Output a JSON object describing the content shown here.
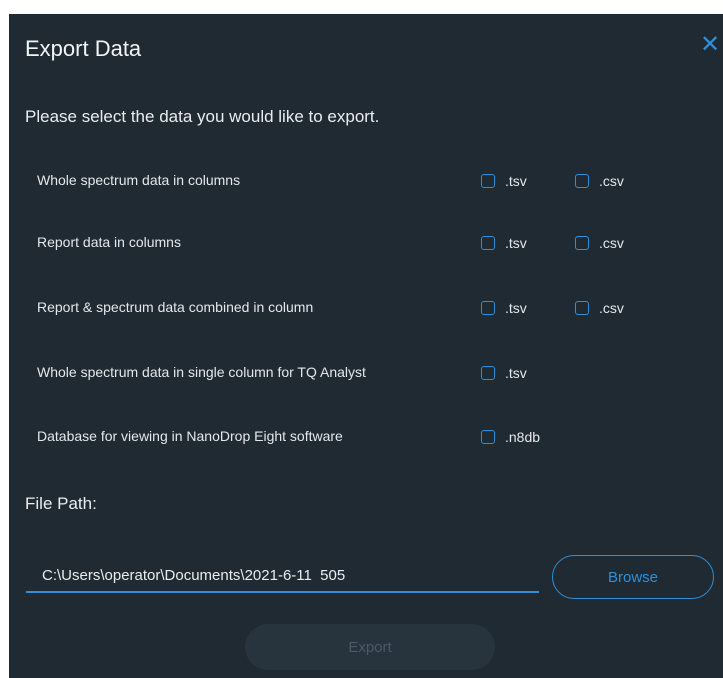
{
  "dialog": {
    "title": "Export Data",
    "close_glyph": "✕",
    "close_icon": "close-icon",
    "instruction": "Please select the data you would like to export.",
    "options": [
      {
        "label": "Whole spectrum data in columns",
        "formats": [
          ".tsv",
          ".csv"
        ],
        "checked": [
          false,
          false
        ]
      },
      {
        "label": "Report data in columns",
        "formats": [
          ".tsv",
          ".csv"
        ],
        "checked": [
          false,
          false
        ]
      },
      {
        "label": "Report & spectrum data combined in column",
        "formats": [
          ".tsv",
          ".csv"
        ],
        "checked": [
          false,
          false
        ]
      },
      {
        "label": "Whole spectrum data in single column for TQ Analyst",
        "formats": [
          ".tsv"
        ],
        "checked": [
          false
        ]
      },
      {
        "label": "Database for viewing in NanoDrop Eight software",
        "formats": [
          ".n8db"
        ],
        "checked": [
          false
        ]
      }
    ],
    "file_path_label": "File Path:",
    "file_path_value": "C:\\Users\\operator\\Documents\\2021-6-11  505",
    "browse_label": "Browse",
    "export_label": "Export",
    "export_enabled": false
  },
  "colors": {
    "background": "#1f2a33",
    "accent": "#2f8fd8",
    "text": "#e9edf0",
    "disabled_button": "#27333d",
    "disabled_text": "#4d5a65"
  }
}
